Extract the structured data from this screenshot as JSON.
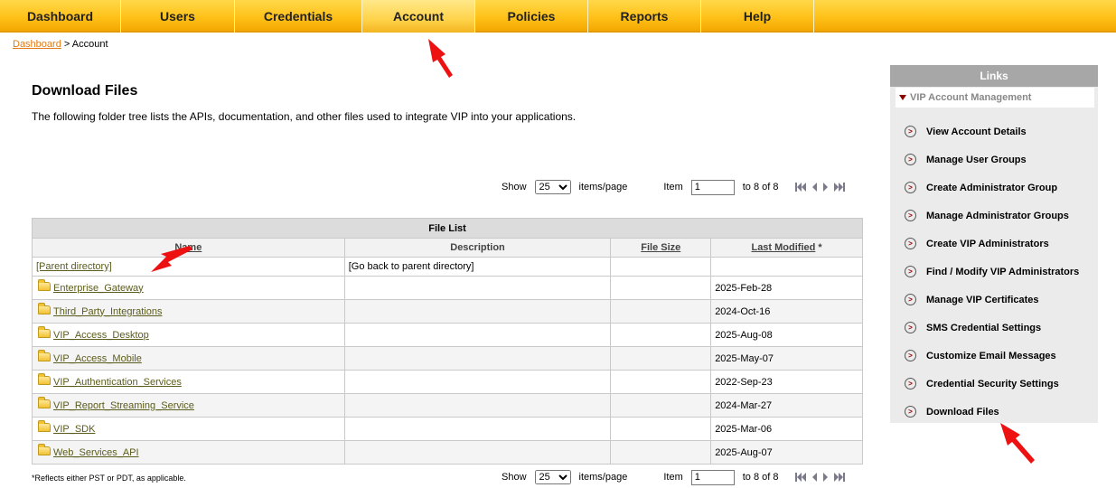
{
  "nav": {
    "items": [
      {
        "label": "Dashboard",
        "active": false
      },
      {
        "label": "Users",
        "active": false
      },
      {
        "label": "Credentials",
        "active": false
      },
      {
        "label": "Account",
        "active": true
      },
      {
        "label": "Policies",
        "active": false
      },
      {
        "label": "Reports",
        "active": false
      },
      {
        "label": "Help",
        "active": false
      }
    ]
  },
  "breadcrumb": {
    "link": "Dashboard",
    "separator": ">",
    "current": "Account"
  },
  "page": {
    "title": "Download Files",
    "description": "The following folder tree lists the APIs, documentation, and other files used to integrate VIP into your applications."
  },
  "pager": {
    "show_label": "Show",
    "page_size": "25",
    "items_per_page_label": "items/page",
    "item_label": "Item",
    "item_value": "1",
    "range_text": "to 8 of 8"
  },
  "table": {
    "caption": "File List",
    "columns": {
      "name": "Name",
      "description": "Description",
      "size": "File Size",
      "modified": "Last Modified",
      "modified_mark": "*"
    },
    "parent": {
      "name": "[Parent directory]",
      "description": "[Go back to parent directory]"
    },
    "rows": [
      {
        "name": "Enterprise_Gateway",
        "description": "",
        "size": "",
        "modified": "2025-Feb-28"
      },
      {
        "name": "Third_Party_Integrations",
        "description": "",
        "size": "",
        "modified": "2024-Oct-16"
      },
      {
        "name": "VIP_Access_Desktop",
        "description": "",
        "size": "",
        "modified": "2025-Aug-08"
      },
      {
        "name": "VIP_Access_Mobile",
        "description": "",
        "size": "",
        "modified": "2025-May-07"
      },
      {
        "name": "VIP_Authentication_Services",
        "description": "",
        "size": "",
        "modified": "2022-Sep-23"
      },
      {
        "name": "VIP_Report_Streaming_Service",
        "description": "",
        "size": "",
        "modified": "2024-Mar-27"
      },
      {
        "name": "VIP_SDK",
        "description": "",
        "size": "",
        "modified": "2025-Mar-06"
      },
      {
        "name": "Web_Services_API",
        "description": "",
        "size": "",
        "modified": "2025-Aug-07"
      }
    ]
  },
  "footnote": "*Reflects either PST or PDT, as applicable.",
  "links": {
    "header": "Links",
    "section": "VIP Account Management",
    "items": [
      "View Account Details",
      "Manage User Groups",
      "Create Administrator Group",
      "Manage Administrator Groups",
      "Create VIP Administrators",
      "Find / Modify VIP Administrators",
      "Manage VIP Certificates",
      "SMS Credential Settings",
      "Customize Email Messages",
      "Credential Security Settings",
      "Download Files"
    ],
    "item_icon": ">"
  },
  "colors": {
    "nav_gold": "#ffc21a",
    "breadcrumb_link": "#e07b17",
    "annotation_arrow": "#ee1111",
    "section_triangle": "#8b0000"
  },
  "icons": {
    "folder": "folder-icon",
    "link_bullet": "circle-arrow-icon",
    "annotation": "red-arrow-icon"
  }
}
